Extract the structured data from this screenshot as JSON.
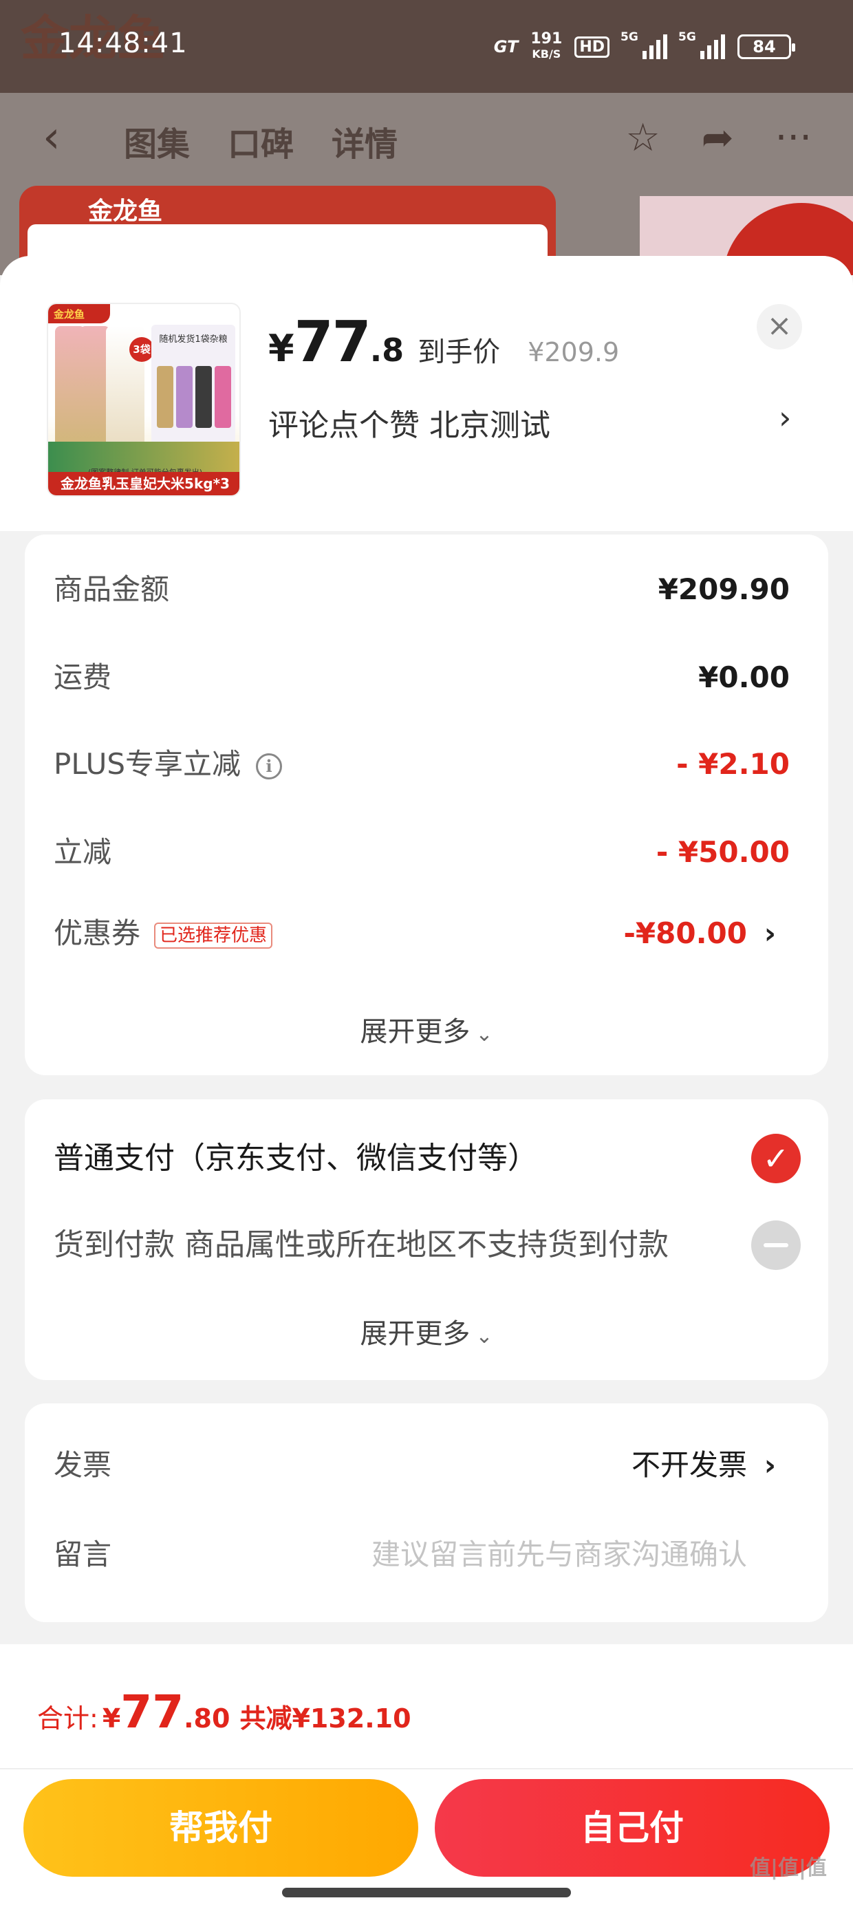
{
  "status_bar": {
    "time": "14:48:41",
    "carrier_mark": "GT",
    "net_speed": "191",
    "net_unit": "KB/S",
    "hd_label": "HD",
    "signal_1": "5G",
    "signal_2": "5G",
    "battery": "84"
  },
  "background_page": {
    "brand": "金龙鱼",
    "tabs": [
      "图集",
      "口碑",
      "详情"
    ],
    "product_brand": "金龙鱼"
  },
  "product": {
    "thumb_brand": "金龙鱼",
    "thumb_badge": "3袋",
    "thumb_box_text": "随机发货1袋杂粮",
    "thumb_small_text": "(图案整律制 订单可能分包裹发出)",
    "thumb_caption": "金龙鱼乳玉皇妃大米5kg*3",
    "price_symbol": "¥",
    "price_int": "77",
    "price_dec": ".8",
    "price_label": "到手价",
    "original_price": "¥209.9",
    "spec": "评论点个赞  北京测试"
  },
  "fees": {
    "goods_label": "商品金额",
    "goods_value": "¥209.90",
    "shipping_label": "运费",
    "shipping_value": "¥0.00",
    "plus_label": "PLUS专享立减",
    "plus_value": "- ¥2.10",
    "instant_label": "立减",
    "instant_value": "- ¥50.00",
    "coupon_label": "优惠券",
    "coupon_tag": "已选推荐优惠",
    "coupon_value": "-¥80.00",
    "expand_label": "展开更多"
  },
  "payment": {
    "normal_label": "普通支付（京东支付、微信支付等）",
    "cod_label": "货到付款 商品属性或所在地区不支持货到付款",
    "expand_label": "展开更多"
  },
  "extras": {
    "invoice_label": "发票",
    "invoice_value": "不开发票",
    "message_label": "留言",
    "message_placeholder": "建议留言前先与商家沟通确认"
  },
  "footer": {
    "total_label": "合计:",
    "total_symbol": "¥",
    "total_int": "77",
    "total_dec": ".80",
    "saved": "共减¥132.10",
    "help_pay_label": "帮我付",
    "self_pay_label": "自己付",
    "watermark": "值|值|值"
  },
  "colors": {
    "accent_red": "#e1251b",
    "help_button": "#ffb400",
    "self_button": "#f5302a"
  }
}
